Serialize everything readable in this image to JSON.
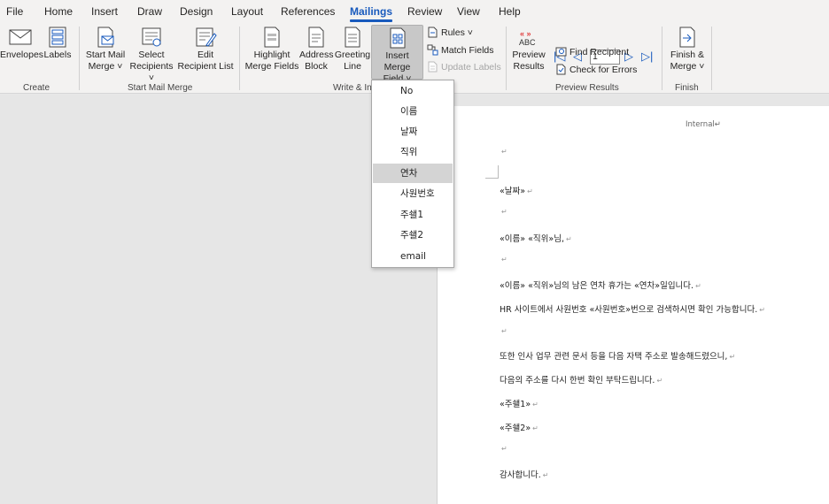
{
  "tabs": [
    "File",
    "Home",
    "Insert",
    "Draw",
    "Design",
    "Layout",
    "References",
    "Mailings",
    "Review",
    "View",
    "Help"
  ],
  "active_tab": "Mailings",
  "ribbon": {
    "create": {
      "envelopes": "Envelopes",
      "labels": "Labels",
      "group": "Create"
    },
    "start_mail_merge": {
      "start_l1": "Start Mail",
      "start_l2": "Merge ˅",
      "select_l1": "Select",
      "select_l2": "Recipients ˅",
      "edit_l1": "Edit",
      "edit_l2": "Recipient List",
      "group": "Start Mail Merge"
    },
    "write_insert": {
      "highlight_l1": "Highlight",
      "highlight_l2": "Merge Fields",
      "address_l1": "Address",
      "address_l2": "Block",
      "greeting_l1": "Greeting",
      "greeting_l2": "Line",
      "insert_l1": "Insert Merge",
      "insert_l2": "Field ˅",
      "rules": "Rules ˅",
      "match_fields": "Match Fields",
      "update_labels": "Update Labels",
      "group": "Write & In"
    },
    "preview": {
      "preview_l1": "Preview",
      "preview_l2": "Results",
      "abc": "ABC",
      "record": "1",
      "find_recipient": "Find Recipient",
      "check_errors": "Check for Errors",
      "group": "Preview Results"
    },
    "finish": {
      "finish_l1": "Finish &",
      "finish_l2": "Merge ˅",
      "group": "Finish"
    }
  },
  "dropdown": {
    "items": [
      "No",
      "이름",
      "날짜",
      "직위",
      "연차",
      "사원번호",
      "주쇌1",
      "주쇌2",
      "email"
    ],
    "highlighted": "연차"
  },
  "document": {
    "header": "Internal↵",
    "lines": [
      "",
      "«날짜»",
      "",
      "«이름» «직위»님,",
      "",
      "«이름» «직위»님의 남은 연차 휴가는 «연차»일입니다.",
      "HR 사이트에서 사원번호 «사원번호»번으로 검색하시면 확인 가능합니다.",
      "",
      "또한 인사 업무 관련 문서 등을 다음 자택 주소로 발송해드렸으니,",
      "다음의 주소를 다시 한번 확인 부탁드립니다.",
      "«주쇌1»",
      "«주쇌2»",
      "",
      "감사합니다."
    ],
    "paragraph_mark": "↵"
  },
  "colors": {
    "accent": "#185abd",
    "ribbon_bg": "#f3f2f1",
    "pressed": "#c8c8c8",
    "highlight": "#d4d4d4"
  }
}
